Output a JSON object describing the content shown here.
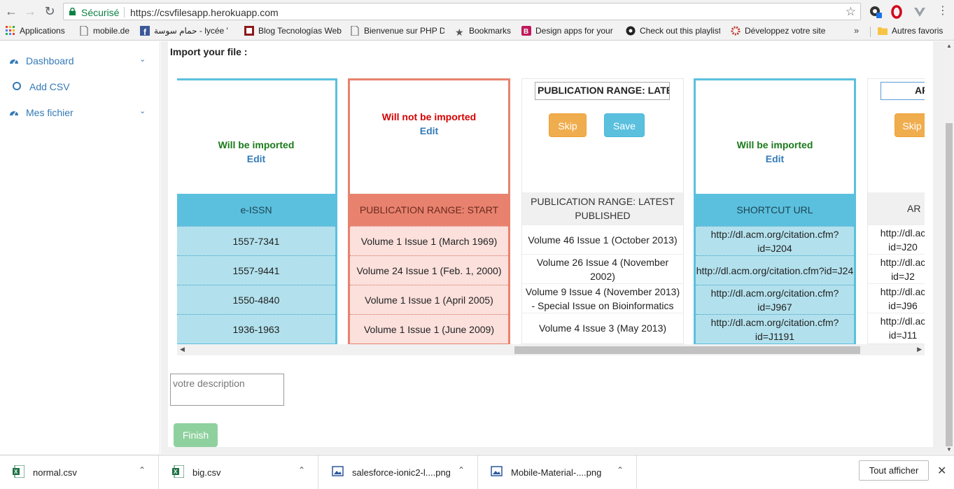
{
  "browser": {
    "secure_label": "Sécurisé",
    "url": "https://csvfilesapp.herokuapp.com",
    "bookmarks": [
      "Applications",
      "mobile.de",
      "حمام سوسة - lycée '",
      "Blog Tecnologías Web",
      "Bienvenue sur PHP Débutant",
      "Bookmarks",
      "Design apps for your",
      "Check out this playlist",
      "Développez votre site"
    ],
    "more": "»",
    "other_bookmarks": "Autres favoris"
  },
  "sidebar": {
    "items": [
      {
        "label": "Dashboard",
        "icon": "dashboard-icon"
      },
      {
        "label": "Add CSV",
        "icon": "circle-icon"
      },
      {
        "label": "Mes fichier",
        "icon": "dashboard-icon"
      }
    ]
  },
  "main": {
    "import_title": "Import your file :",
    "columns": [
      {
        "state": "imported",
        "status": "Will be imported",
        "edit": "Edit",
        "header": "e-ISSN",
        "cells": [
          "1557-7341",
          "1557-9441",
          "1550-4840",
          "1936-1963"
        ]
      },
      {
        "state": "notimported",
        "status": "Will not be imported",
        "edit": "Edit",
        "header": "PUBLICATION RANGE: START",
        "cells": [
          "Volume 1 Issue 1 (March 1969)",
          "Volume 24 Issue 1 (Feb. 1, 2000)",
          "Volume 1 Issue 1 (April 2005)",
          "Volume 1 Issue 1 (June 2009)"
        ]
      },
      {
        "state": "editing",
        "input_value": "PUBLICATION RANGE: LATE",
        "skip": "Skip",
        "save": "Save",
        "header": "PUBLICATION RANGE: LATEST PUBLISHED",
        "cells": [
          "Volume 46 Issue 1 (October 2013)",
          "Volume 26 Issue 4 (November 2002)",
          "Volume 9 Issue 4 (November 2013) - Special Issue on Bioinformatics",
          "Volume 4 Issue 3 (May 2013)"
        ]
      },
      {
        "state": "imported",
        "status": "Will be imported",
        "edit": "Edit",
        "header": "SHORTCUT URL",
        "cells": [
          "http://dl.acm.org/citation.cfm?id=J204",
          "http://dl.acm.org/citation.cfm?id=J24",
          "http://dl.acm.org/citation.cfm?id=J967",
          "http://dl.acm.org/citation.cfm?id=J1191"
        ]
      },
      {
        "state": "editing",
        "input_value": "AR",
        "skip": "Skip",
        "header": "AR",
        "cells": [
          "http://dl.ac id=J20",
          "http://dl.ac id=J2",
          "http://dl.ac id=J96",
          "http://dl.ac id=J11"
        ]
      }
    ],
    "description_placeholder": "votre description",
    "finish": "Finish"
  },
  "downloads": {
    "items": [
      {
        "name": "normal.csv",
        "icon": "excel-icon"
      },
      {
        "name": "big.csv",
        "icon": "excel-icon"
      },
      {
        "name": "salesforce-ionic2-l....png",
        "icon": "image-icon"
      },
      {
        "name": "Mobile-Material-....png",
        "icon": "image-icon"
      }
    ],
    "show_all": "Tout afficher"
  },
  "colors": {
    "imported_blue": "#5bc0de",
    "not_imported_red": "#e8826e",
    "skip_orange": "#f0ad4e",
    "finish_green": "#8fd19e",
    "link_blue": "#337ab7"
  }
}
